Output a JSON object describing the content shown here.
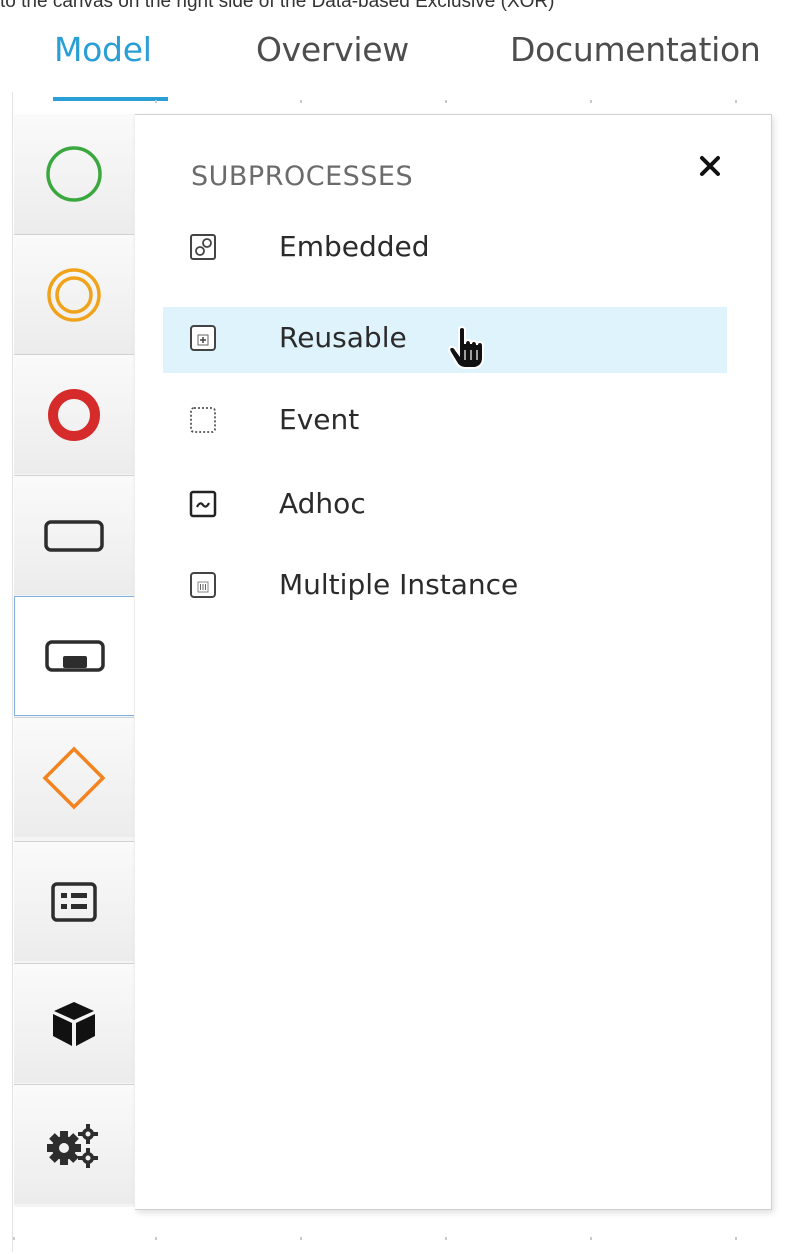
{
  "caption": "to the canvas on the right side of the Data-based Exclusive (XOR)",
  "tabs": [
    {
      "label": "Model",
      "active": true
    },
    {
      "label": "Overview",
      "active": false
    },
    {
      "label": "Documentation",
      "active": false
    }
  ],
  "toolbar": {
    "items": [
      {
        "name": "start-events",
        "icon": "green-circle-icon"
      },
      {
        "name": "intermediate-events",
        "icon": "orange-double-circle-icon"
      },
      {
        "name": "end-events",
        "icon": "red-bold-circle-icon"
      },
      {
        "name": "activities",
        "icon": "rounded-rectangle-icon"
      },
      {
        "name": "subprocesses",
        "icon": "subprocess-icon",
        "selected": true
      },
      {
        "name": "gateways",
        "icon": "orange-diamond-icon"
      },
      {
        "name": "containers",
        "icon": "list-box-icon"
      },
      {
        "name": "custom-tasks",
        "icon": "cube-icon"
      },
      {
        "name": "advanced",
        "icon": "gears-icon"
      }
    ]
  },
  "panel": {
    "title": "SUBPROCESSES",
    "close_label": "×",
    "items": [
      {
        "label": "Embedded",
        "icon": "embedded-subprocess-icon"
      },
      {
        "label": "Reusable",
        "icon": "reusable-subprocess-icon",
        "hovered": true
      },
      {
        "label": "Event",
        "icon": "event-subprocess-icon"
      },
      {
        "label": "Adhoc",
        "icon": "adhoc-subprocess-icon"
      },
      {
        "label": "Multiple Instance",
        "icon": "multiple-instance-subprocess-icon"
      }
    ]
  },
  "colors": {
    "accent": "#2a9fd6",
    "hover_bg": "#def3fb",
    "start_event": "#3aa83e",
    "intermediate_event": "#f0a21a",
    "end_event": "#d52b2b",
    "gateway": "#f2831f"
  }
}
